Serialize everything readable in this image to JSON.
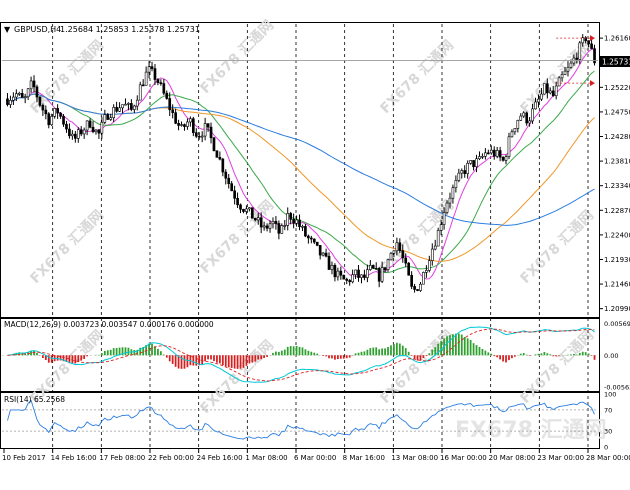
{
  "header": {
    "symbol_text": "GBPUSD,H4",
    "ohlc_text": "1.25684 1.25853 1.25378 1.25731"
  },
  "price_label": "1.25731",
  "macd": {
    "title": "MACD(12,26,9) 0.003723 0.003547 0.000176 0.000000"
  },
  "rsi": {
    "title": "RSI(14) 65.2568"
  },
  "watermark": "FX678 汇通网",
  "colors": {
    "candle": "#000000",
    "ma_fast": "#e040e0",
    "ma_mid": "#3aa84a",
    "ma_slow": "#f0962a",
    "ma_long": "#2a7de0",
    "macd_up": "#2ea02e",
    "macd_down": "#d62020",
    "macd_line": "#00c8d8",
    "signal_line": "#e02020",
    "rsi_line": "#2a7de0",
    "grid": "#000000"
  },
  "chart_data": [
    {
      "type": "candlestick",
      "title": "GBPUSD,H4",
      "x_ticks": [
        "10 Feb 2017",
        "14 Feb 16:00",
        "17 Feb 08:00",
        "22 Feb 00:00",
        "24 Feb 16:00",
        "1 Mar 08:00",
        "6 Mar 00:00",
        "8 Mar 16:00",
        "13 Mar 08:00",
        "16 Mar 00:00",
        "20 Mar 08:00",
        "23 Mar 00:00",
        "28 Mar 00:00"
      ],
      "y_ticks": [
        "1.26160",
        "1.25690",
        "1.25220",
        "1.24750",
        "1.24280",
        "1.23810",
        "1.23340",
        "1.22870",
        "1.22400",
        "1.21930",
        "1.21460",
        "1.20990"
      ],
      "ylim": [
        1.2085,
        1.2643
      ],
      "close_path": [
        1.25,
        1.251,
        1.2495,
        1.253,
        1.2488,
        1.246,
        1.2478,
        1.245,
        1.242,
        1.244,
        1.2455,
        1.243,
        1.247,
        1.248,
        1.249,
        1.2478,
        1.252,
        1.2555,
        1.254,
        1.2505,
        1.247,
        1.244,
        1.246,
        1.243,
        1.2445,
        1.241,
        1.237,
        1.233,
        1.23,
        1.2285,
        1.227,
        1.225,
        1.2265,
        1.224,
        1.228,
        1.2265,
        1.224,
        1.222,
        1.22,
        1.218,
        1.216,
        1.215,
        1.2165,
        1.2155,
        1.2175,
        1.216,
        1.219,
        1.223,
        1.2185,
        1.213,
        1.215,
        1.22,
        1.224,
        1.23,
        1.233,
        1.236,
        1.2375,
        1.238,
        1.24,
        1.2395,
        1.238,
        1.244,
        1.247,
        1.246,
        1.249,
        1.252,
        1.2505,
        1.254,
        1.256,
        1.259,
        1.262,
        1.2573
      ],
      "series": [
        {
          "name": "MA fast",
          "color": "#e040e0"
        },
        {
          "name": "MA mid",
          "color": "#3aa84a"
        },
        {
          "name": "MA slow",
          "color": "#f0962a"
        },
        {
          "name": "MA long",
          "color": "#2a7de0"
        }
      ],
      "hlines": [
        1.25731
      ],
      "vlines_at_ticks": true
    },
    {
      "type": "bar",
      "title": "MACD(12,26,9) 0.003723 0.003547 0.000176 0.000000",
      "y_ticks": [
        "0.005697",
        "0.00",
        "-0.005635"
      ],
      "ylim": [
        -0.0062,
        0.0063
      ],
      "values": {
        "macd": 0.003723,
        "signal": 0.003547,
        "hist": 0.000176
      }
    },
    {
      "type": "line",
      "title": "RSI(14) 65.2568",
      "y_ticks": [
        "100",
        "70",
        "30",
        "0"
      ],
      "ylim": [
        0,
        100
      ],
      "levels": [
        70,
        30
      ],
      "last_value": 65.2568
    }
  ]
}
